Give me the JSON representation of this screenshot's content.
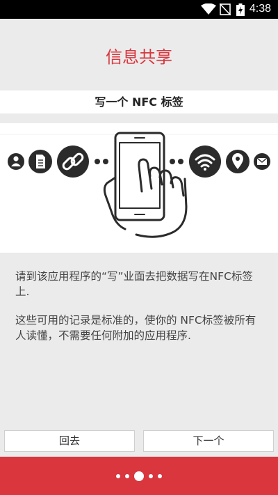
{
  "status_bar": {
    "time": "4:38",
    "icons": [
      "wifi-icon",
      "no-sim-icon",
      "battery-charging-icon"
    ]
  },
  "page": {
    "title": "信息共享",
    "subtitle": "写一个 NFC 标签"
  },
  "illustration": {
    "left_icons": [
      "user-icon",
      "document-icon",
      "link-icon"
    ],
    "right_icons": [
      "wifi-icon",
      "location-pin-icon",
      "mail-icon"
    ],
    "center": "phone-with-hand-icon"
  },
  "description": {
    "para1": "请到该应用程序的“写”业面去把数据写在NFC标签上.",
    "para2": "这些可用的记录是标准的，使你的 NFC标签被所有人读懂，不需要任何附加的应用程序."
  },
  "buttons": {
    "back": "回去",
    "next": "下一个"
  },
  "pager": {
    "total": 5,
    "current": 3
  },
  "colors": {
    "accent": "#d9363e",
    "dark": "#2b2b2b"
  }
}
